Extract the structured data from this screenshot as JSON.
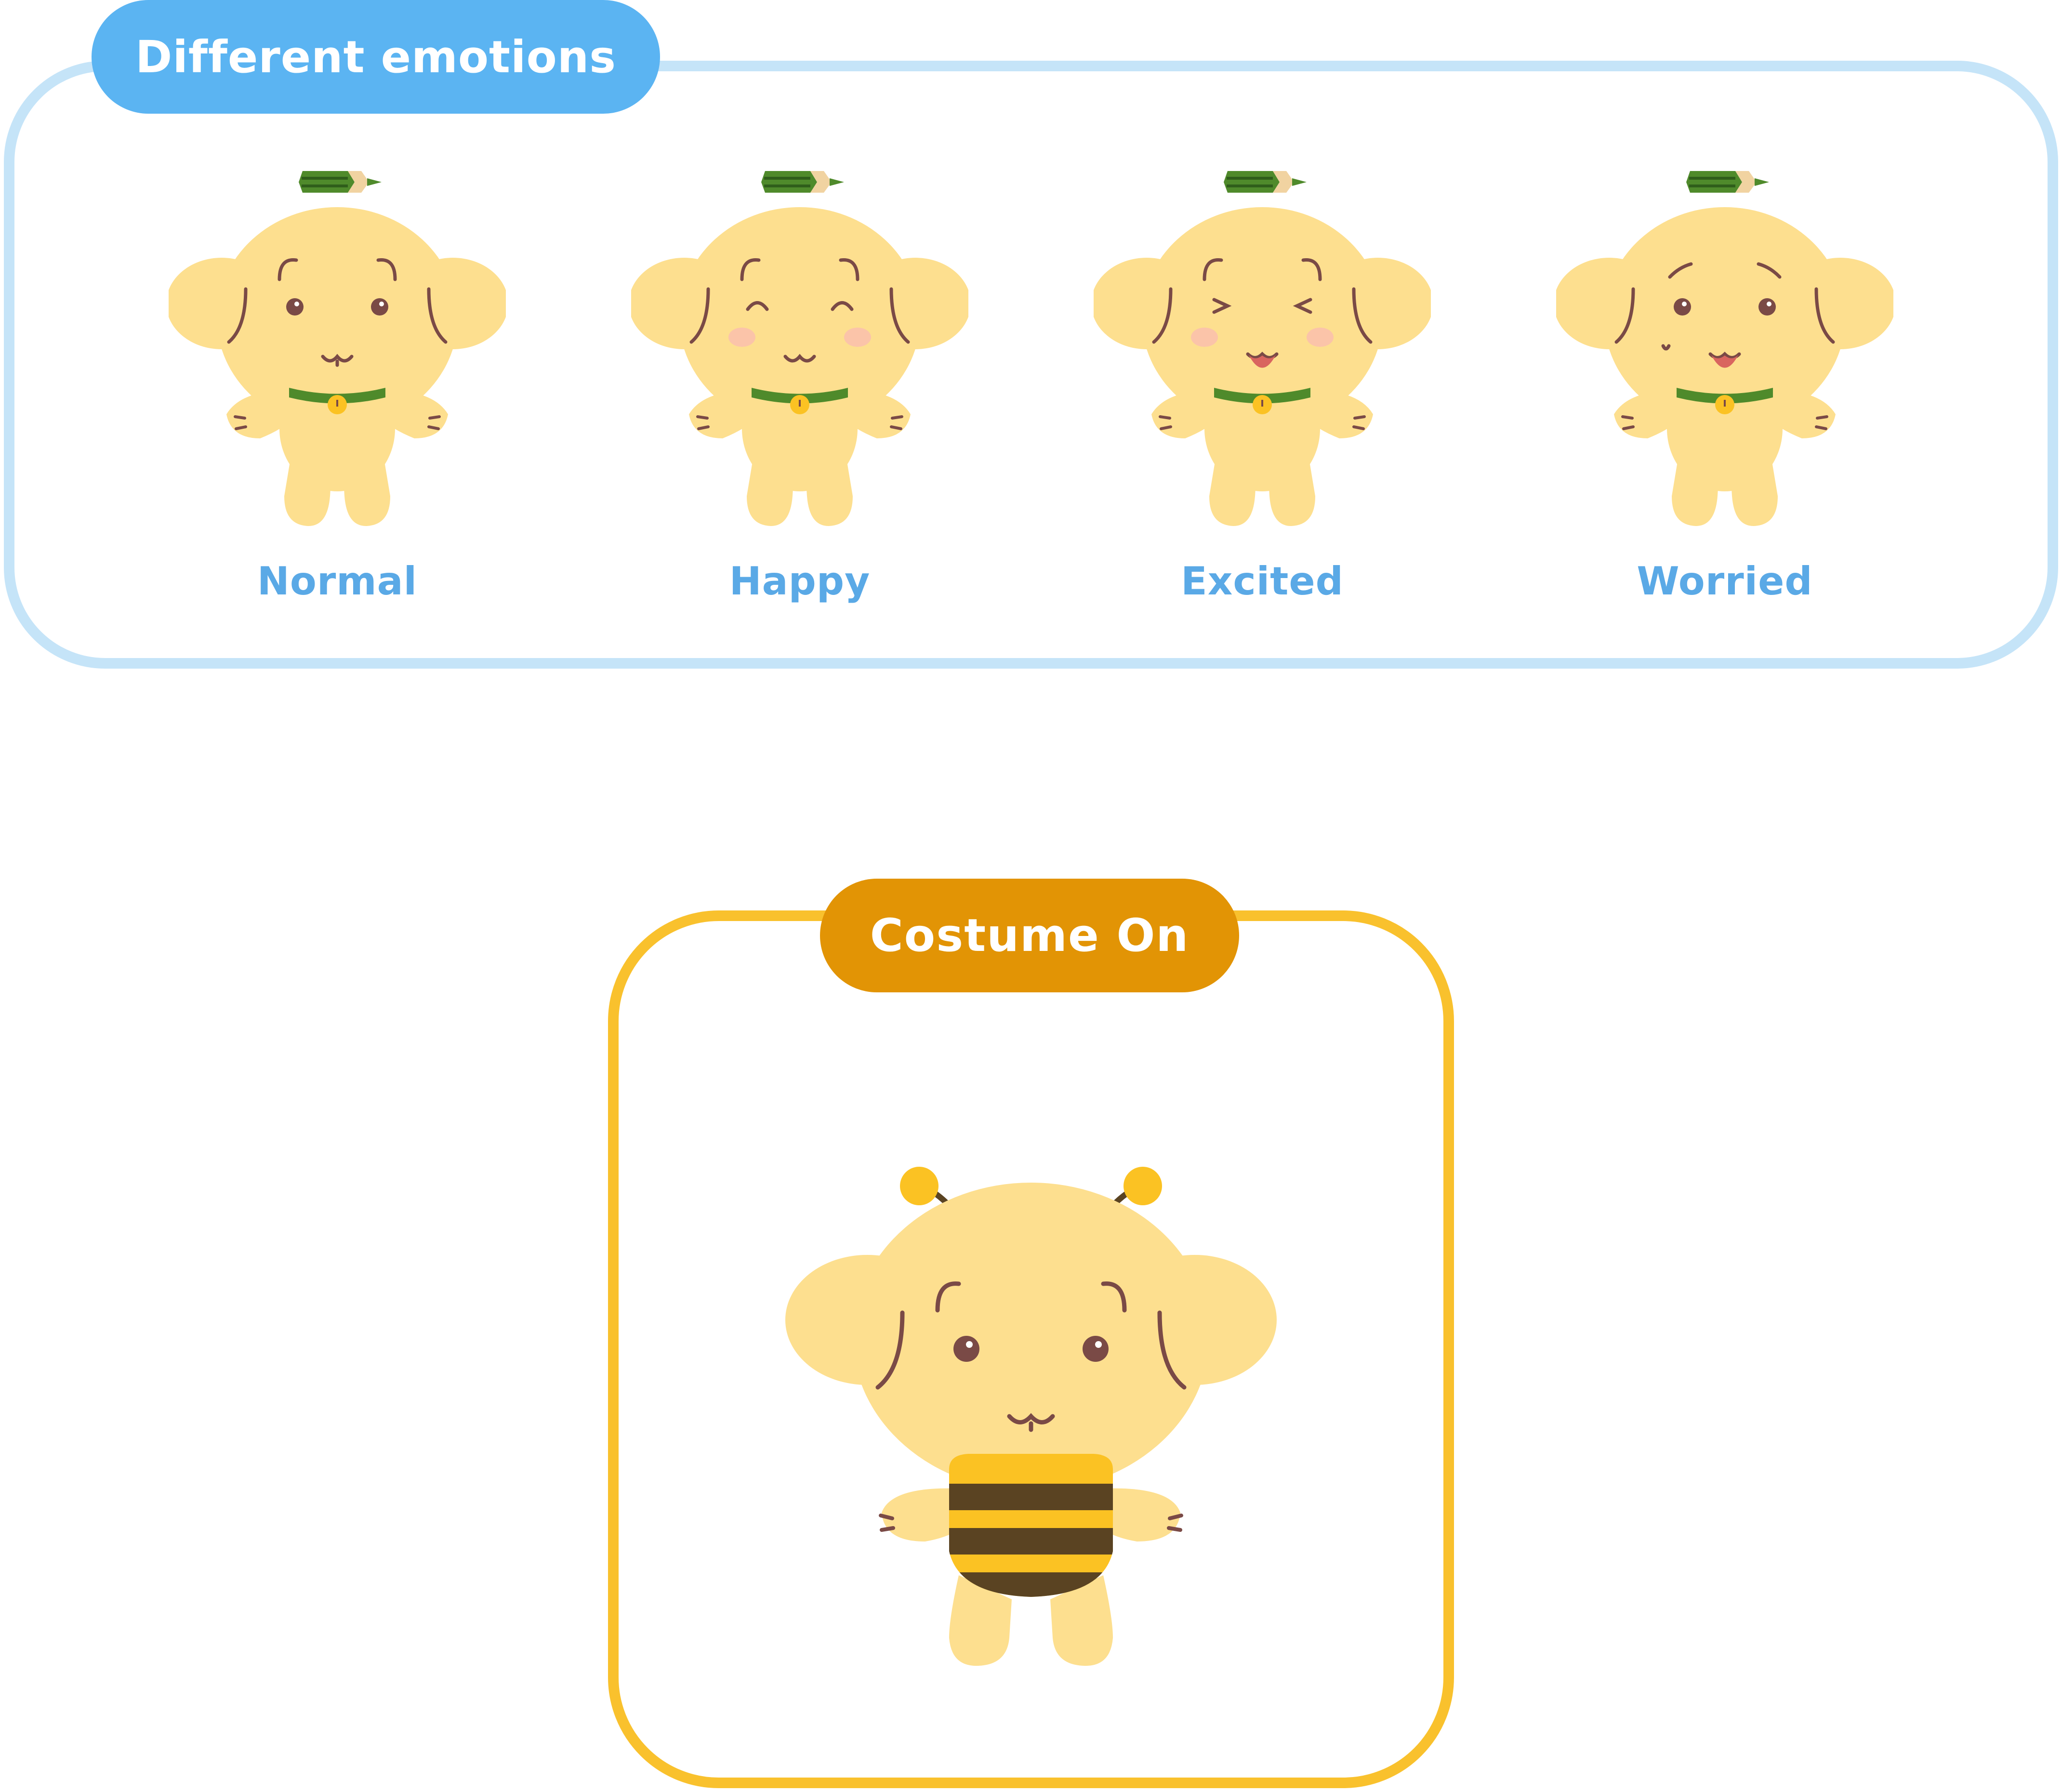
{
  "sections": {
    "emotions": {
      "title": "Different emotions",
      "items": [
        {
          "label": "Normal",
          "expression": "normal"
        },
        {
          "label": "Happy",
          "expression": "happy"
        },
        {
          "label": "Excited",
          "expression": "excited"
        },
        {
          "label": "Worried",
          "expression": "worried"
        }
      ]
    },
    "costume": {
      "title": "Costume On",
      "costume": "bee"
    }
  },
  "colors": {
    "emotions_accent": "#5bb4f2",
    "emotions_border": "#c5e4f8",
    "emotions_label": "#5aa9e6",
    "costume_accent": "#e29405",
    "costume_border": "#f9c12d",
    "mascot_body": "#fddf8f",
    "features": "#7a4a46",
    "pencil_green": "#4f8a2b",
    "bee_stripe_dark": "#5a4322",
    "bee_stripe_yellow": "#fbc223",
    "blush": "#fbc4a9"
  }
}
